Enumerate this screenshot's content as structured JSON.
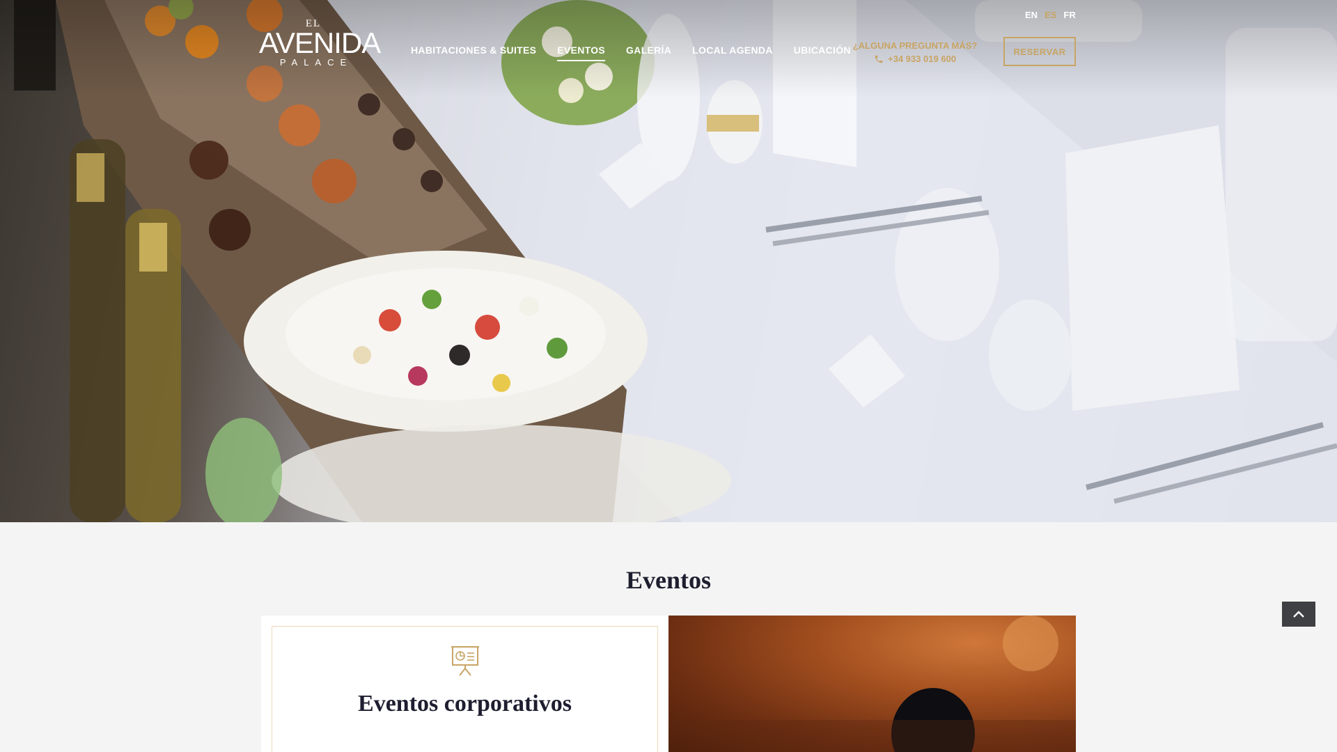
{
  "languages": {
    "en": "EN",
    "es": "ES",
    "fr": "FR",
    "active": "ES"
  },
  "logo": {
    "line1": "EL",
    "line2": "AVENIDA",
    "line3": "PALACE"
  },
  "nav": {
    "items": [
      {
        "label": "HABITACIONES & SUITES"
      },
      {
        "label": "EVENTOS",
        "active": true
      },
      {
        "label": "GALERÍA"
      },
      {
        "label": "LOCAL AGENDA"
      },
      {
        "label": "UBICACIÓN"
      }
    ]
  },
  "contact": {
    "question": "¿ALGUNA PREGUNTA MÁS?",
    "phone": "+34 933 019 600"
  },
  "header": {
    "reserve_label": "RESERVAR"
  },
  "hero": {
    "image": "banquet-table-photo"
  },
  "section": {
    "title": "Eventos"
  },
  "card": {
    "icon": "presentation-board-icon",
    "title": "Eventos corporativos",
    "image": "corporate-event-photo"
  },
  "colors": {
    "accent": "#c8a464",
    "heading": "#1e1e30",
    "background": "#f4f4f4",
    "back_to_top": "#3f4044"
  },
  "back_to_top": {
    "icon": "chevron-up-icon"
  }
}
